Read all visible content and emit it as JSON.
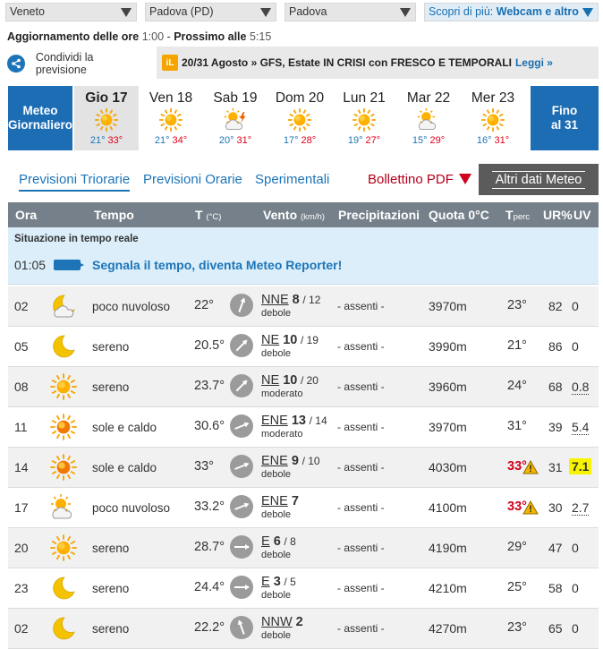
{
  "selects": {
    "region": "Veneto",
    "province": "Padova (PD)",
    "city": "Padova",
    "discover_prefix": "Scopri di più:",
    "discover_bold": "Webcam e altro"
  },
  "update": {
    "label": "Aggiornamento delle ore",
    "time": "1:00",
    "sep": " - ",
    "next_label": "Prossimo alle",
    "next_time": "5:15"
  },
  "share": {
    "label": "Condividi la previsione"
  },
  "news": {
    "badge": "iL",
    "date": "20/31 Agosto",
    "text": "» GFS, Estate IN CRISI con FRESCO E TEMPORALI",
    "more": "Leggi »"
  },
  "daystrip": {
    "left_button": [
      "Meteo",
      "Giornaliero"
    ],
    "right_button": [
      "Fino",
      "al 31"
    ],
    "days": [
      {
        "name": "Gio 17",
        "min": "21°",
        "max": "33°",
        "icon": "sun-icon"
      },
      {
        "name": "Ven 18",
        "min": "21°",
        "max": "34°",
        "icon": "sun-icon"
      },
      {
        "name": "Sab 19",
        "min": "20°",
        "max": "31°",
        "icon": "sun-cloud-storm-icon"
      },
      {
        "name": "Dom 20",
        "min": "17°",
        "max": "28°",
        "icon": "sun-icon"
      },
      {
        "name": "Lun 21",
        "min": "19°",
        "max": "27°",
        "icon": "sun-icon"
      },
      {
        "name": "Mar 22",
        "min": "15°",
        "max": "29°",
        "icon": "sun-cloud-icon"
      },
      {
        "name": "Mer 23",
        "min": "16°",
        "max": "31°",
        "icon": "sun-icon"
      }
    ]
  },
  "tabs": {
    "triorarie": "Previsioni Triorarie",
    "orarie": "Previsioni Orarie",
    "sperimentali": "Sperimentali",
    "pdf": "Bollettino PDF",
    "altri": "Altri dati Meteo"
  },
  "table": {
    "headers": {
      "ora": "Ora",
      "tempo": "Tempo",
      "t": "T",
      "t_unit": "(°C)",
      "vento": "Vento",
      "vento_unit": "(km/h)",
      "prec": "Precipitazioni",
      "quota": "Quota 0°C",
      "tperc": "T",
      "tperc_sub": "perc",
      "ur": "UR%",
      "uv": "UV"
    },
    "realtime": {
      "title": "Situazione in tempo reale",
      "time": "01:05",
      "message": "Segnala il tempo, diventa Meteo Reporter!"
    },
    "rows": [
      {
        "ora": "02",
        "icon": "moon-cloud-icon",
        "desc": "poco nuvoloso",
        "t": "22°",
        "dir": "NNE",
        "speed": "8",
        "gust": "/ 12",
        "strength": "debole",
        "prec": "- assenti -",
        "quota": "3970m",
        "tperc": "23°",
        "hot": false,
        "ur": "82",
        "uv": "0",
        "uv_hi": false,
        "uv_u": false
      },
      {
        "ora": "05",
        "icon": "moon-icon",
        "desc": "sereno",
        "t": "20.5°",
        "dir": "NE",
        "speed": "10",
        "gust": "/ 19",
        "strength": "debole",
        "prec": "- assenti -",
        "quota": "3990m",
        "tperc": "21°",
        "hot": false,
        "ur": "86",
        "uv": "0",
        "uv_hi": false,
        "uv_u": false
      },
      {
        "ora": "08",
        "icon": "sun-icon",
        "desc": "sereno",
        "t": "23.7°",
        "dir": "NE",
        "speed": "10",
        "gust": "/ 20",
        "strength": "moderato",
        "prec": "- assenti -",
        "quota": "3960m",
        "tperc": "24°",
        "hot": false,
        "ur": "68",
        "uv": "0.8",
        "uv_hi": false,
        "uv_u": true
      },
      {
        "ora": "11",
        "icon": "hot-sun-icon",
        "desc": "sole e caldo",
        "t": "30.6°",
        "dir": "ENE",
        "speed": "13",
        "gust": "/ 14",
        "strength": "moderato",
        "prec": "- assenti -",
        "quota": "3970m",
        "tperc": "31°",
        "hot": false,
        "ur": "39",
        "uv": "5.4",
        "uv_hi": false,
        "uv_u": true
      },
      {
        "ora": "14",
        "icon": "hot-sun-icon",
        "desc": "sole e caldo",
        "t": "33°",
        "dir": "ENE",
        "speed": "9",
        "gust": "/ 10",
        "strength": "debole",
        "prec": "- assenti -",
        "quota": "4030m",
        "tperc": "33°",
        "hot": true,
        "ur": "31",
        "uv": "7.1",
        "uv_hi": true,
        "uv_u": false
      },
      {
        "ora": "17",
        "icon": "sun-cloud-icon",
        "desc": "poco nuvoloso",
        "t": "33.2°",
        "dir": "ENE",
        "speed": "7",
        "gust": "",
        "strength": "debole",
        "prec": "- assenti -",
        "quota": "4100m",
        "tperc": "33°",
        "hot": true,
        "ur": "30",
        "uv": "2.7",
        "uv_hi": false,
        "uv_u": true
      },
      {
        "ora": "20",
        "icon": "sun-icon",
        "desc": "sereno",
        "t": "28.7°",
        "dir": "E",
        "speed": "6",
        "gust": "/ 8",
        "strength": "debole",
        "prec": "- assenti -",
        "quota": "4190m",
        "tperc": "29°",
        "hot": false,
        "ur": "47",
        "uv": "0",
        "uv_hi": false,
        "uv_u": false
      },
      {
        "ora": "23",
        "icon": "moon-icon",
        "desc": "sereno",
        "t": "24.4°",
        "dir": "E",
        "speed": "3",
        "gust": "/ 5",
        "strength": "debole",
        "prec": "- assenti -",
        "quota": "4210m",
        "tperc": "25°",
        "hot": false,
        "ur": "58",
        "uv": "0",
        "uv_hi": false,
        "uv_u": false
      },
      {
        "ora": "02",
        "icon": "moon-icon",
        "desc": "sereno",
        "t": "22.2°",
        "dir": "NNW",
        "speed": "2",
        "gust": "",
        "strength": "debole",
        "prec": "- assenti -",
        "quota": "4270m",
        "tperc": "23°",
        "hot": false,
        "ur": "65",
        "uv": "0",
        "uv_hi": false,
        "uv_u": false
      }
    ]
  },
  "colors": {
    "brand_blue": "#1d6db5",
    "link_blue": "#1d75b8",
    "hot_red": "#d0021b",
    "header_grey": "#76808a",
    "realtime_bg": "#dbeef9",
    "uv_high": "#f8f400"
  }
}
